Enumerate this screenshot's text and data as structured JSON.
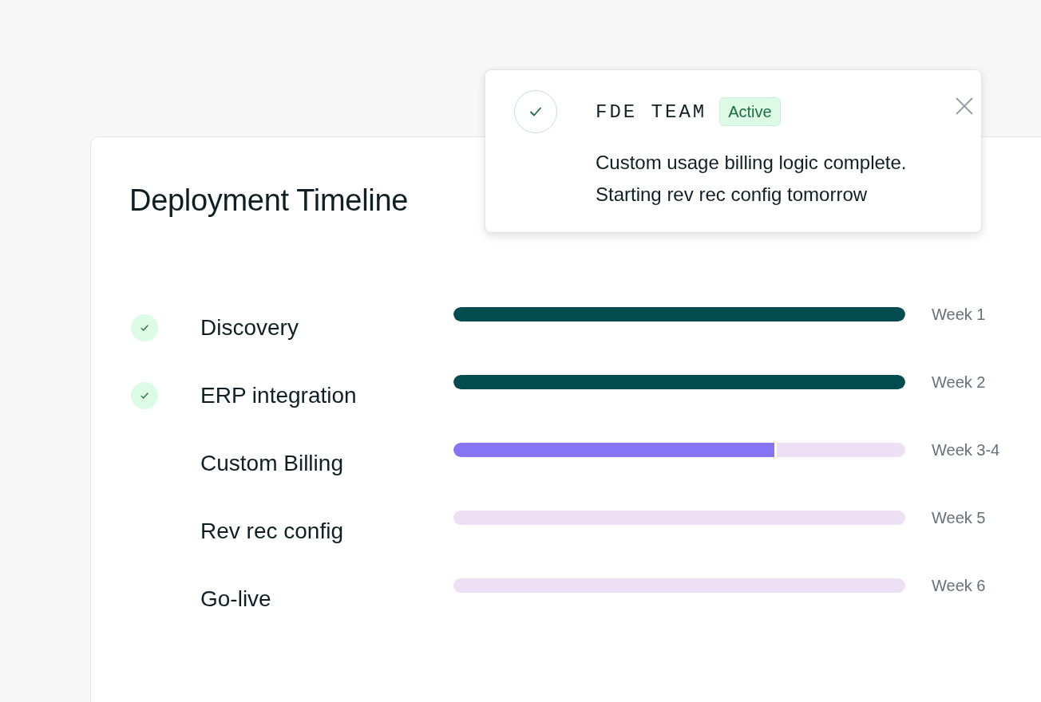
{
  "timeline": {
    "title": "Deployment Timeline",
    "phases": [
      {
        "name": "Discovery",
        "done": true,
        "level": 1,
        "period": "Week 1"
      },
      {
        "name": "ERP integration",
        "done": true,
        "level": 1,
        "period": "Week 2"
      },
      {
        "name": "Custom Billing",
        "done": false,
        "level": 0.71,
        "period": "Week 3-4"
      },
      {
        "name": "Rev rec config",
        "done": false,
        "level": 0,
        "period": "Week 5"
      },
      {
        "name": "Go-live",
        "done": false,
        "level": 0,
        "period": "Week 6"
      }
    ]
  },
  "notification": {
    "team": "FDE TEAM",
    "badge": "Active",
    "message": "Custom usage billing logic complete. Starting rev rec config tomorrow"
  }
}
